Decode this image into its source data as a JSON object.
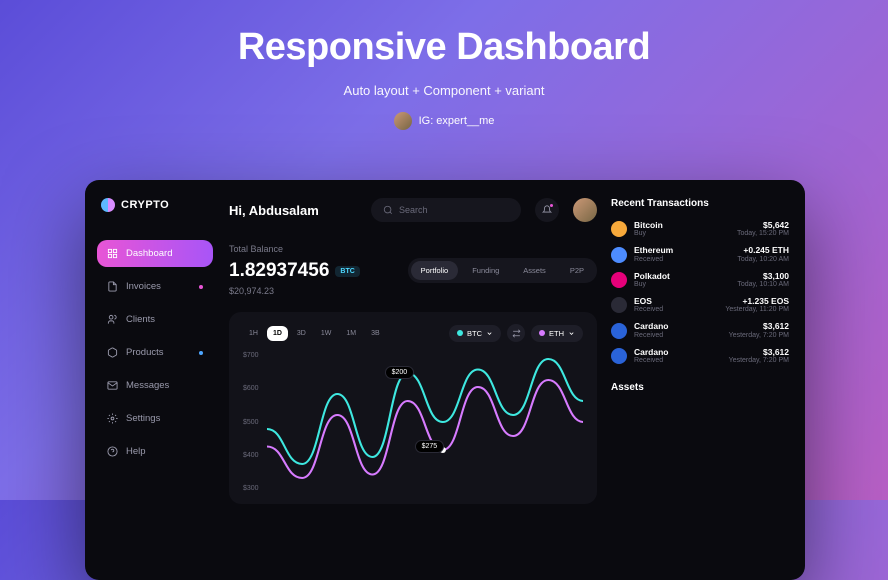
{
  "hero": {
    "title": "Responsive Dashboard",
    "subtitle": "Auto layout + Component + variant",
    "author": "IG: expert__me"
  },
  "app": {
    "brand": "CRYPTO",
    "greeting": "Hi, Abdusalam",
    "search_placeholder": "Search"
  },
  "sidebar": {
    "items": [
      {
        "label": "Dashboard",
        "icon": "grid"
      },
      {
        "label": "Invoices",
        "icon": "doc"
      },
      {
        "label": "Clients",
        "icon": "users"
      },
      {
        "label": "Products",
        "icon": "box"
      },
      {
        "label": "Messages",
        "icon": "mail"
      },
      {
        "label": "Settings",
        "icon": "gear"
      },
      {
        "label": "Help",
        "icon": "help"
      }
    ]
  },
  "balance": {
    "label": "Total Balance",
    "value": "1.82937456",
    "currency": "BTC",
    "usd": "$20,974.23"
  },
  "portfolio_tabs": [
    "Portfolio",
    "Funding",
    "Assets",
    "P2P"
  ],
  "chart": {
    "ranges": [
      "1H",
      "1D",
      "3D",
      "1W",
      "1M",
      "3B"
    ],
    "active_range": "1D",
    "coin_a": {
      "label": "BTC",
      "color": "#3ee8e0"
    },
    "coin_b": {
      "label": "ETH",
      "color": "#d77bff"
    },
    "y_ticks": [
      "$700",
      "$600",
      "$500",
      "$400",
      "$300"
    ],
    "labels": [
      {
        "value": "$200"
      },
      {
        "value": "$275"
      }
    ]
  },
  "chart_data": {
    "type": "line",
    "ylim": [
      300,
      700
    ],
    "y_ticks": [
      300,
      400,
      500,
      600,
      700
    ],
    "series": [
      {
        "name": "BTC",
        "color": "#3ee8e0",
        "values": [
          480,
          380,
          580,
          400,
          640,
          500,
          650,
          520,
          680,
          560
        ]
      },
      {
        "name": "ETH",
        "color": "#d77bff",
        "values": [
          430,
          340,
          520,
          350,
          560,
          420,
          600,
          460,
          620,
          500
        ]
      }
    ],
    "annotations": [
      {
        "series": "BTC",
        "index": 4,
        "label": "$200"
      },
      {
        "series": "ETH",
        "index": 5,
        "label": "$275"
      }
    ]
  },
  "transactions": {
    "title": "Recent Transactions",
    "items": [
      {
        "name": "Bitcoin",
        "sub": "Buy",
        "amount": "$5,642",
        "time": "Today, 15:20 PM",
        "color": "#f7a93b"
      },
      {
        "name": "Ethereum",
        "sub": "Received",
        "amount": "+0.245 ETH",
        "time": "Today, 10:20 AM",
        "color": "#4d8cff"
      },
      {
        "name": "Polkadot",
        "sub": "Buy",
        "amount": "$3,100",
        "time": "Today, 10:10 AM",
        "color": "#e6007a"
      },
      {
        "name": "EOS",
        "sub": "Received",
        "amount": "+1.235 EOS",
        "time": "Yesterday, 11:20 PM",
        "color": "#2a2a36"
      },
      {
        "name": "Cardano",
        "sub": "Received",
        "amount": "$3,612",
        "time": "Yesterday, 7:20 PM",
        "color": "#2a63d8"
      },
      {
        "name": "Cardano",
        "sub": "Received",
        "amount": "$3,612",
        "time": "Yesterday, 7:20 PM",
        "color": "#2a63d8"
      }
    ]
  },
  "assets": {
    "title": "Assets"
  }
}
